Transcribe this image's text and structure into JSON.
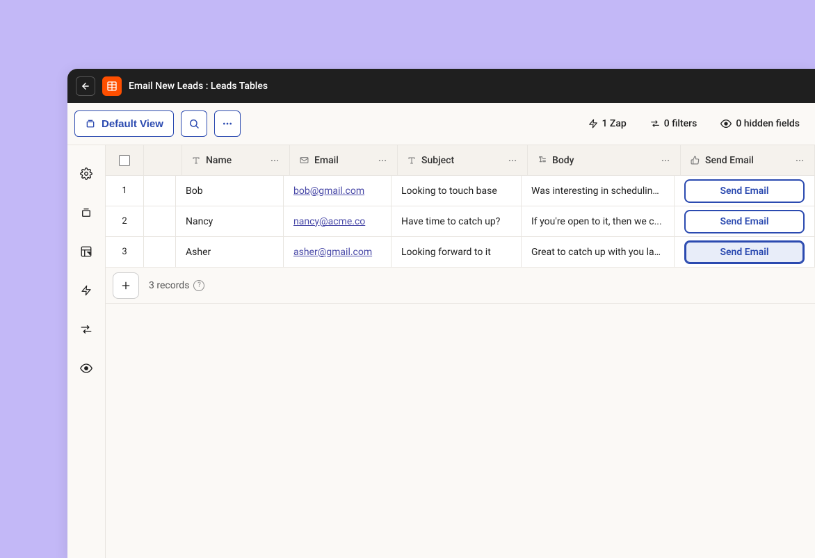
{
  "header": {
    "title": "Email New Leads : Leads Tables"
  },
  "toolbar": {
    "default_view_label": "Default View",
    "zap_label": "1 Zap",
    "filters_label": "0 filters",
    "hidden_fields_label": "0 hidden fields"
  },
  "columns": [
    {
      "id": "name",
      "label": "Name",
      "icon": "text"
    },
    {
      "id": "email",
      "label": "Email",
      "icon": "mail"
    },
    {
      "id": "subject",
      "label": "Subject",
      "icon": "text"
    },
    {
      "id": "body",
      "label": "Body",
      "icon": "longtext"
    },
    {
      "id": "send",
      "label": "Send Email",
      "icon": "thumb"
    }
  ],
  "rows": [
    {
      "rownum": "1",
      "name": "Bob",
      "email": "bob@gmail.com",
      "subject": "Looking to touch base",
      "body": "Was interesting in scheduling ...",
      "send_label": "Send Email"
    },
    {
      "rownum": "2",
      "name": "Nancy",
      "email": "nancy@acme.co",
      "subject": "Have time to catch up?",
      "body": "If you're open to it, then we c...",
      "send_label": "Send Email"
    },
    {
      "rownum": "3",
      "name": "Asher",
      "email": "asher@gmail.com",
      "subject": "Looking forward to it",
      "body": "Great to catch up with you las...",
      "send_label": "Send Email"
    }
  ],
  "footer": {
    "records_label": "3 records"
  }
}
